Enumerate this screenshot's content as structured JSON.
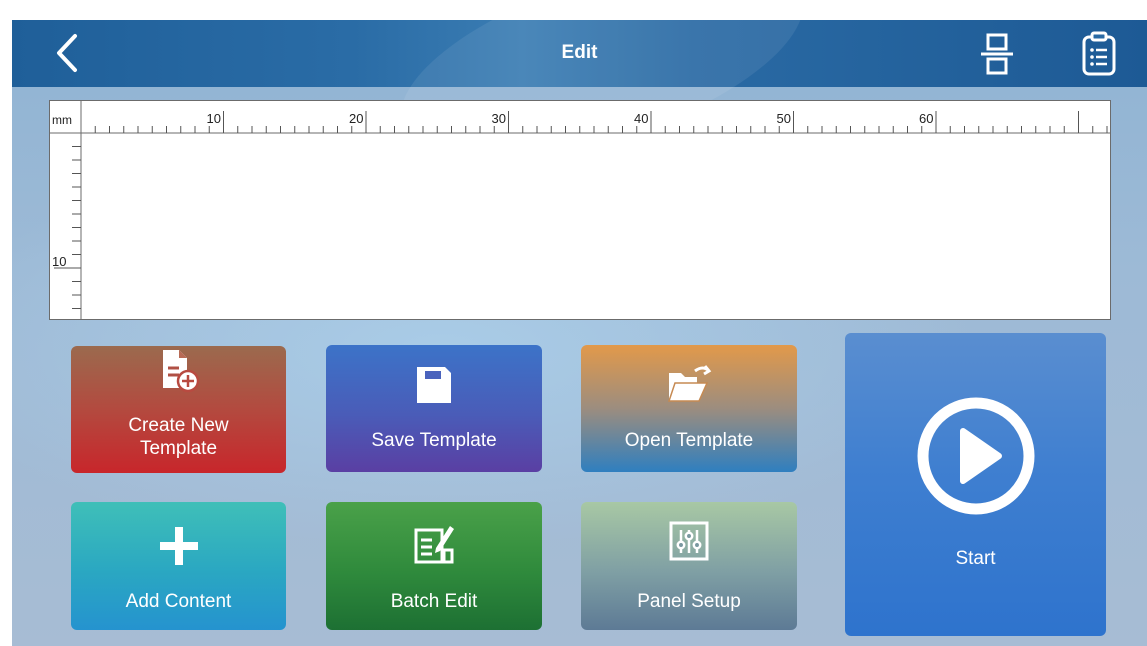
{
  "header": {
    "title": "Edit",
    "icons": {
      "back": "chevron-left-icon",
      "layout": "print-layout-icon",
      "list": "list-document-icon"
    }
  },
  "ruler": {
    "unit": "mm",
    "top_labels": [
      "10",
      "20",
      "30",
      "40",
      "50",
      "60"
    ],
    "left_labels": [
      "10"
    ]
  },
  "actions": {
    "create": {
      "label_line1": "Create New",
      "label_line2": "Template",
      "icon": "new-file-plus-icon"
    },
    "save": {
      "label": "Save Template",
      "icon": "save-floppy-icon"
    },
    "open": {
      "label": "Open Template",
      "icon": "open-folder-icon"
    },
    "add": {
      "label": "Add Content",
      "icon": "plus-icon"
    },
    "batch": {
      "label": "Batch Edit",
      "icon": "batch-edit-icon"
    },
    "panel": {
      "label": "Panel Setup",
      "icon": "sliders-icon"
    },
    "start": {
      "label": "Start",
      "icon": "play-circle-icon"
    }
  },
  "colors": {
    "header": "#2a6ca6",
    "create": "#c8262b",
    "save": "#4a5cb8",
    "open": "#2f7fbf",
    "add": "#2aa7c2",
    "batch": "#2f8a3c",
    "panel": "#7f9fa4",
    "start": "#3f7fd0"
  }
}
